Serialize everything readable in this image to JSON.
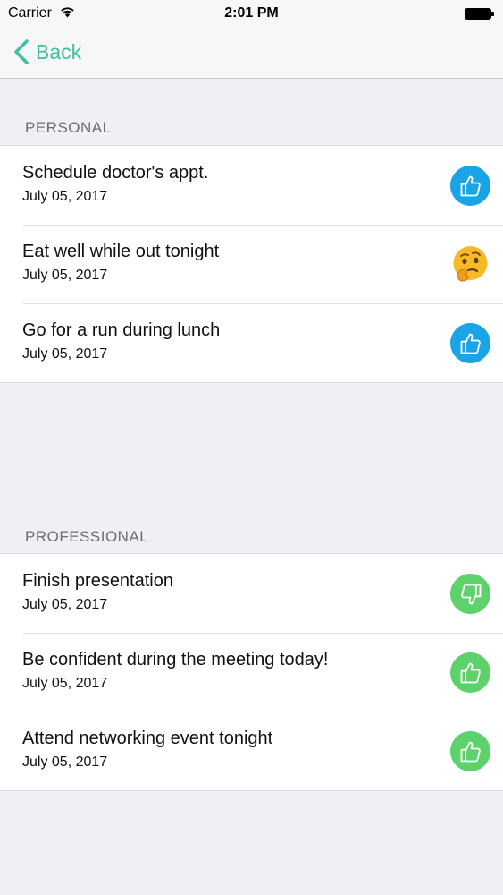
{
  "status_bar": {
    "carrier": "Carrier",
    "time": "2:01 PM"
  },
  "nav": {
    "back_label": "Back",
    "accent_color": "#3fbfa0"
  },
  "sections": [
    {
      "header": "PERSONAL",
      "items": [
        {
          "title": "Schedule doctor's appt.",
          "date": "July 05, 2017",
          "icon": "thumbs-up-icon",
          "color": "#1aa4e6"
        },
        {
          "title": "Eat well while out tonight",
          "date": "July 05, 2017",
          "icon": "thinking-face-icon",
          "color": "#f5b81c"
        },
        {
          "title": "Go for a run during lunch",
          "date": "July 05, 2017",
          "icon": "thumbs-up-icon",
          "color": "#1aa4e6"
        }
      ]
    },
    {
      "header": "PROFESSIONAL",
      "items": [
        {
          "title": "Finish presentation",
          "date": "July 05, 2017",
          "icon": "thumbs-down-icon",
          "color": "#5ed26a"
        },
        {
          "title": "Be confident during the meeting today!",
          "date": "July 05, 2017",
          "icon": "thumbs-up-icon",
          "color": "#5ed26a"
        },
        {
          "title": "Attend networking event tonight",
          "date": "July 05, 2017",
          "icon": "thumbs-up-icon",
          "color": "#5ed26a"
        }
      ]
    }
  ]
}
